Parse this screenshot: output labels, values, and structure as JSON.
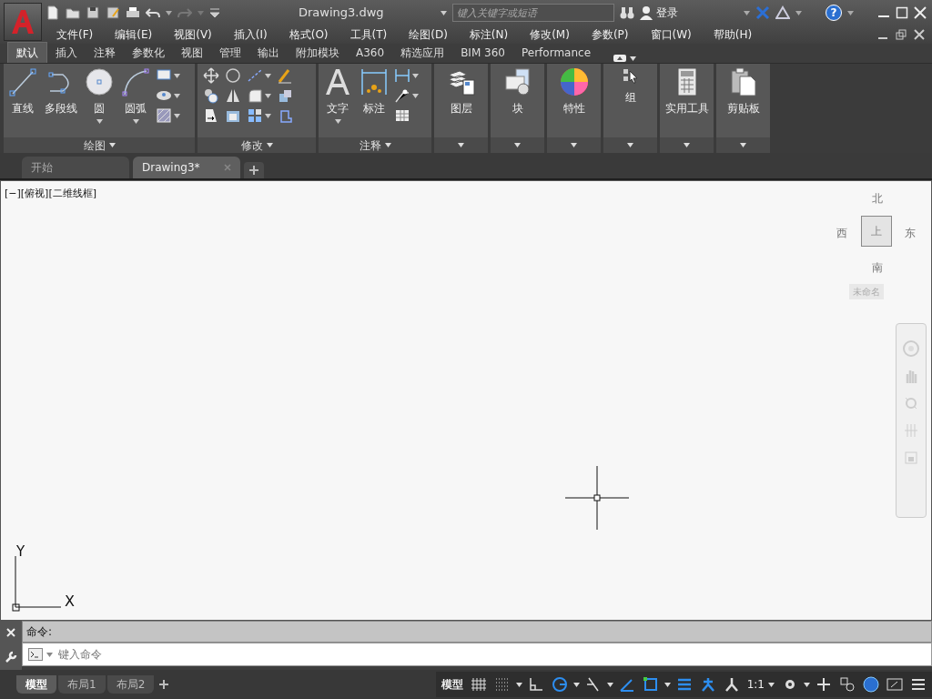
{
  "title_bar": {
    "title": "Drawing3.dwg",
    "search": {
      "placeholder": "键入关键字或短语"
    },
    "sign_in": "登录",
    "help": "?"
  },
  "menu": [
    "文件(F)",
    "编辑(E)",
    "视图(V)",
    "插入(I)",
    "格式(O)",
    "工具(T)",
    "绘图(D)",
    "标注(N)",
    "修改(M)",
    "参数(P)",
    "窗口(W)",
    "帮助(H)"
  ],
  "ribbon_tabs": [
    {
      "label": "默认",
      "selected": true
    },
    {
      "label": "插入",
      "selected": false
    },
    {
      "label": "注释",
      "selected": false
    },
    {
      "label": "参数化",
      "selected": false
    },
    {
      "label": "视图",
      "selected": false
    },
    {
      "label": "管理",
      "selected": false
    },
    {
      "label": "输出",
      "selected": false
    },
    {
      "label": "附加模块",
      "selected": false
    },
    {
      "label": "A360",
      "selected": false
    },
    {
      "label": "精选应用",
      "selected": false
    },
    {
      "label": "BIM 360",
      "selected": false
    },
    {
      "label": "Performance",
      "selected": false
    }
  ],
  "panels": [
    {
      "kind": "draw",
      "title": "绘图",
      "tools": [
        {
          "kind": "line",
          "label": "直线",
          "has_menu": false
        },
        {
          "kind": "polyline",
          "label": "多段线",
          "has_menu": false
        },
        {
          "kind": "circle",
          "label": "圆",
          "has_menu": true
        },
        {
          "kind": "arc",
          "label": "圆弧",
          "has_menu": true
        }
      ]
    },
    {
      "kind": "modify",
      "title": "修改"
    },
    {
      "kind": "annotate",
      "title": "注释",
      "tools": [
        {
          "kind": "text",
          "label": "文字",
          "has_menu": true
        },
        {
          "kind": "dim",
          "label": "标注",
          "has_menu": false
        }
      ]
    },
    {
      "kind": "layers",
      "label": "图层"
    },
    {
      "kind": "block",
      "label": "块"
    },
    {
      "kind": "properties",
      "label": "特性"
    },
    {
      "kind": "group",
      "label": "组"
    },
    {
      "kind": "utilities",
      "label": "实用工具"
    },
    {
      "kind": "clipboard",
      "label": "剪贴板"
    }
  ],
  "doc_tabs": [
    {
      "label": "开始",
      "selected": false
    },
    {
      "label": "Drawing3*",
      "selected": true
    }
  ],
  "viewport_label": "[−][俯视][二维线框]",
  "viewcube": {
    "north": "北",
    "west": "西",
    "east": "东",
    "south": "南",
    "face": "上",
    "wcs": "未命名"
  },
  "ucs": {
    "x": "X",
    "y": "Y"
  },
  "command": {
    "history": "命令:",
    "input": {
      "placeholder": "键入命令"
    }
  },
  "layout_tabs": [
    {
      "label": "模型",
      "selected": true
    },
    {
      "label": "布局1",
      "selected": false
    },
    {
      "label": "布局2",
      "selected": false
    }
  ],
  "status_bar": {
    "model": "模型",
    "scale": "1:1",
    "toggles": [
      {
        "kind": "grid",
        "on": false
      },
      {
        "kind": "snap",
        "on": false
      },
      {
        "kind": "ortho",
        "on": false
      },
      {
        "kind": "polar",
        "on": true
      },
      {
        "kind": "isodraft",
        "on": false
      },
      {
        "kind": "otrack",
        "on": true
      },
      {
        "kind": "osnap",
        "on": true
      },
      {
        "kind": "lineweight",
        "on": true
      },
      {
        "kind": "annotative",
        "on": true
      },
      {
        "kind": "autoscale",
        "on": false
      }
    ]
  }
}
